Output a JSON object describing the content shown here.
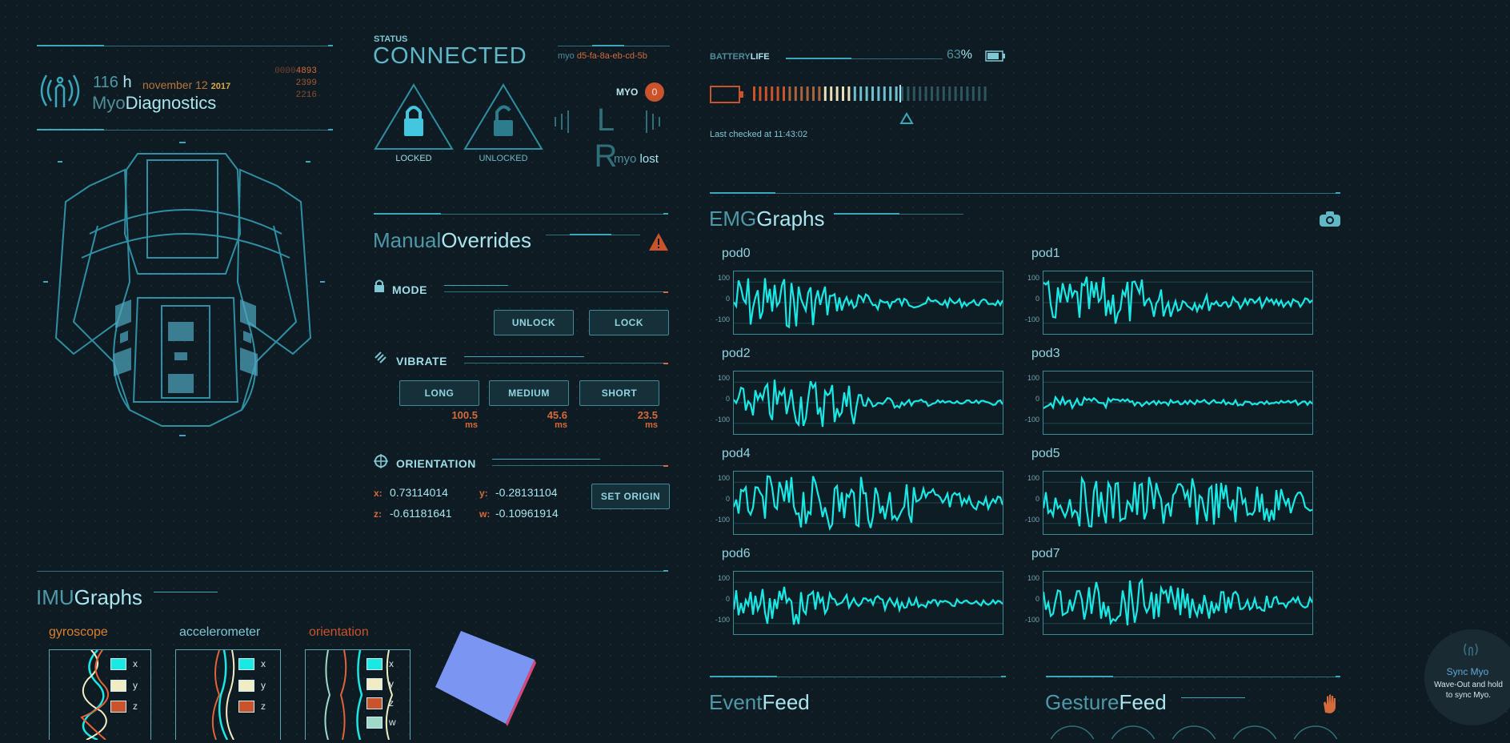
{
  "header": {
    "hours": "116",
    "hours_unit": "h",
    "date": "november 12",
    "year": "2017",
    "counter_prefix": "0000",
    "counter_main": "4893",
    "counter2": "2399",
    "counter3": "2216",
    "app_name_light": "Myo",
    "app_name_bold": "Diagnostics"
  },
  "status": {
    "label": "STATUS",
    "value": "CONNECTED",
    "device_prefix": "myo",
    "device_id": "d5-fa-8a-eb-cd-5b",
    "myo_label": "MYO",
    "myo_count": "0",
    "locked_label": "LOCKED",
    "unlocked_label": "UNLOCKED",
    "arm_letters": "L R",
    "myo_state_prefix": "myo",
    "myo_state": "lost"
  },
  "battery": {
    "label_light": "BATTERY",
    "label_bold": "LIFE",
    "percent_value": "63",
    "percent_sign": "%",
    "level": 0.63,
    "last_checked": "Last checked at 11:43:02"
  },
  "manual": {
    "title_light": "Manual",
    "title_bold": "Overrides",
    "mode_label": "MODE",
    "unlock_btn": "UNLOCK",
    "lock_btn": "LOCK",
    "vibrate_label": "VIBRATE",
    "long_btn": "LONG",
    "medium_btn": "MEDIUM",
    "short_btn": "SHORT",
    "long_val": "100.5",
    "medium_val": "45.6",
    "short_val": "23.5",
    "ms": "ms",
    "orientation_label": "ORIENTATION",
    "x_label": "x:",
    "x_val": "0.73114014",
    "y_label": "y:",
    "y_val": "-0.28131104",
    "z_label": "z:",
    "z_val": "-0.61181641",
    "w_label": "w:",
    "w_val": "-0.10961914",
    "set_origin_btn": "SET ORIGIN"
  },
  "emg": {
    "title_light": "EMG",
    "title_bold": "Graphs",
    "y_ticks": [
      "100",
      "0",
      "-100"
    ],
    "pods": [
      "pod0",
      "pod1",
      "pod2",
      "pod3",
      "pod4",
      "pod5",
      "pod6",
      "pod7"
    ]
  },
  "imu": {
    "title_light": "IMU",
    "title_bold": "Graphs",
    "gyroscope": "gyroscope",
    "accelerometer": "accelerometer",
    "orientation": "orientation",
    "legend_x": "x",
    "legend_y": "y",
    "legend_z": "z",
    "legend_w": "w"
  },
  "feeds": {
    "event_light": "Event",
    "event_bold": "Feed",
    "gesture_light": "Gesture",
    "gesture_bold": "Feed"
  },
  "sync": {
    "title": "Sync Myo",
    "instruction": "Wave-Out and hold to sync Myo."
  },
  "icons": {
    "logo": "myo-logo-icon",
    "lock": "lock-icon",
    "vibrate": "vibrate-icon",
    "orientation": "crosshair-icon",
    "warning": "warning-icon",
    "battery": "battery-icon",
    "camera": "camera-icon",
    "hand": "hand-icon"
  },
  "colors": {
    "accent": "#3aa9bd",
    "cyan_signal": "#19e8e4",
    "orange": "#d56a3c",
    "background": "#0f1b22"
  }
}
